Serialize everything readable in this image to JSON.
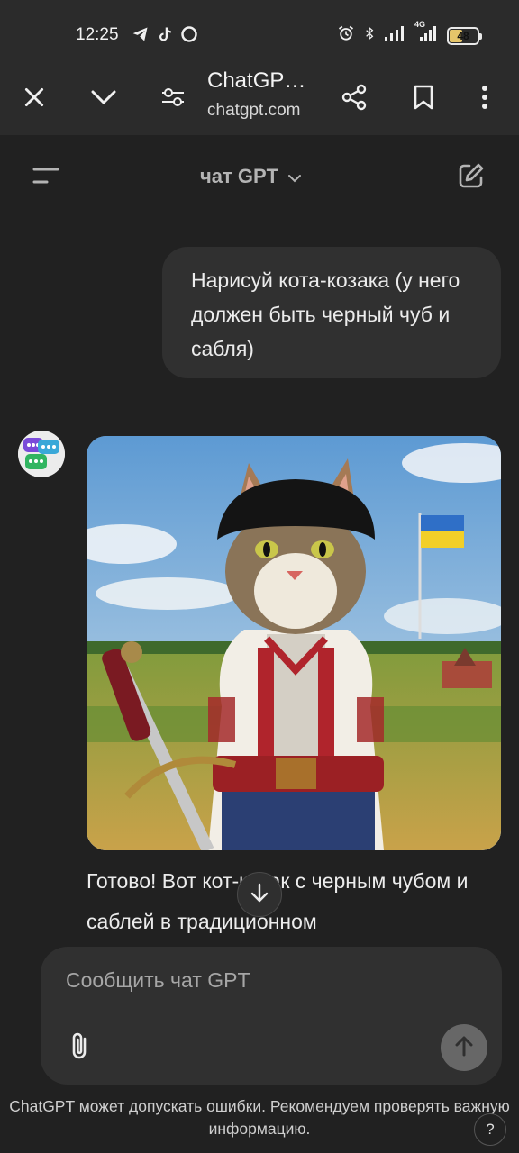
{
  "status_bar": {
    "time": "12:25",
    "battery": "48",
    "battery_level_percent": 48,
    "network": "4G",
    "left_icons": [
      "telegram-icon",
      "tiktok-icon",
      "c-app-icon"
    ],
    "right_icons": [
      "alarm-icon",
      "bluetooth-icon",
      "signal-icon",
      "signal-4g-icon",
      "battery-icon"
    ]
  },
  "browser": {
    "title": "ChatGP…",
    "url": "chatgpt.com",
    "buttons": [
      "close-icon",
      "chevron-down-icon",
      "site-settings-icon",
      "share-icon",
      "bookmark-icon",
      "more-vert-icon"
    ]
  },
  "chat_header": {
    "model": "чат GPT"
  },
  "messages": {
    "user": "Нарисуй кота-козака (у него должен быть черный чуб и сабля)",
    "assistant_text": "Готово! Вот кот-козак с черным чубом и саблей в традиционном"
  },
  "composer": {
    "placeholder": "Сообщить чат GPT"
  },
  "disclaimer": "ChatGPT может допускать ошибки. Рекомендуем проверять важную информацию.",
  "help": "?",
  "colors": {
    "background": "#212121",
    "bar": "#2b2b2b",
    "bubble": "#303030",
    "text": "#ececec",
    "muted": "#b4b4b4",
    "send_button": "#676767"
  }
}
